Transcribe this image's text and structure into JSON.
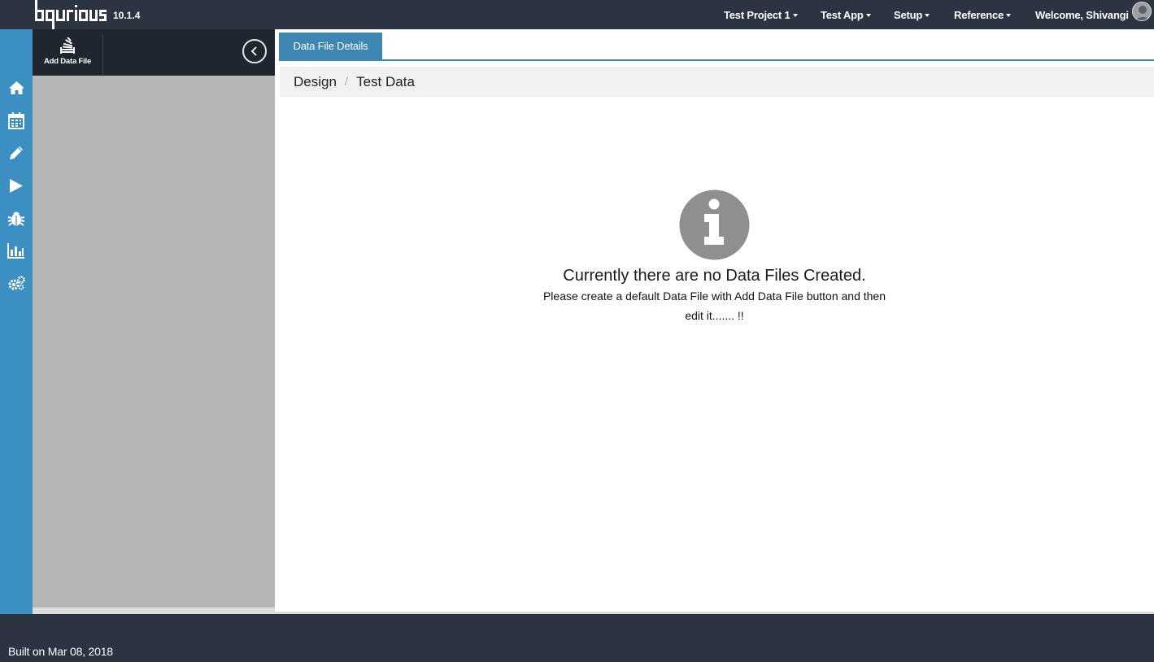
{
  "app": {
    "logo_text": "bqurious",
    "version": "10.1.4"
  },
  "header": {
    "nav": [
      {
        "label": "Test Project 1"
      },
      {
        "label": "Test App"
      },
      {
        "label": "Setup"
      },
      {
        "label": "Reference"
      }
    ],
    "welcome": "Welcome, Shivangi"
  },
  "rail": {
    "icons": [
      "home-icon",
      "calendar-icon",
      "pencil-icon",
      "play-icon",
      "bug-icon",
      "bar-chart-icon",
      "gears-icon"
    ]
  },
  "side": {
    "add_label": "Add Data File"
  },
  "main": {
    "tab_label": "Data File Details",
    "breadcrumb": [
      "Design",
      "Test Data"
    ],
    "breadcrumb_sep": "/",
    "empty_title": "Currently there are no Data Files Created.",
    "empty_desc": "Please create a default Data File with Add Data File button and then edit it....... !!"
  },
  "footer": {
    "built": "Built on Mar 08, 2018"
  },
  "colors": {
    "topbar": "#2b3440",
    "rail": "#3b8fc2",
    "tab": "#3d87b2",
    "side_panel": "#b5b6b5",
    "empty_icon": "#8f8f8f"
  }
}
